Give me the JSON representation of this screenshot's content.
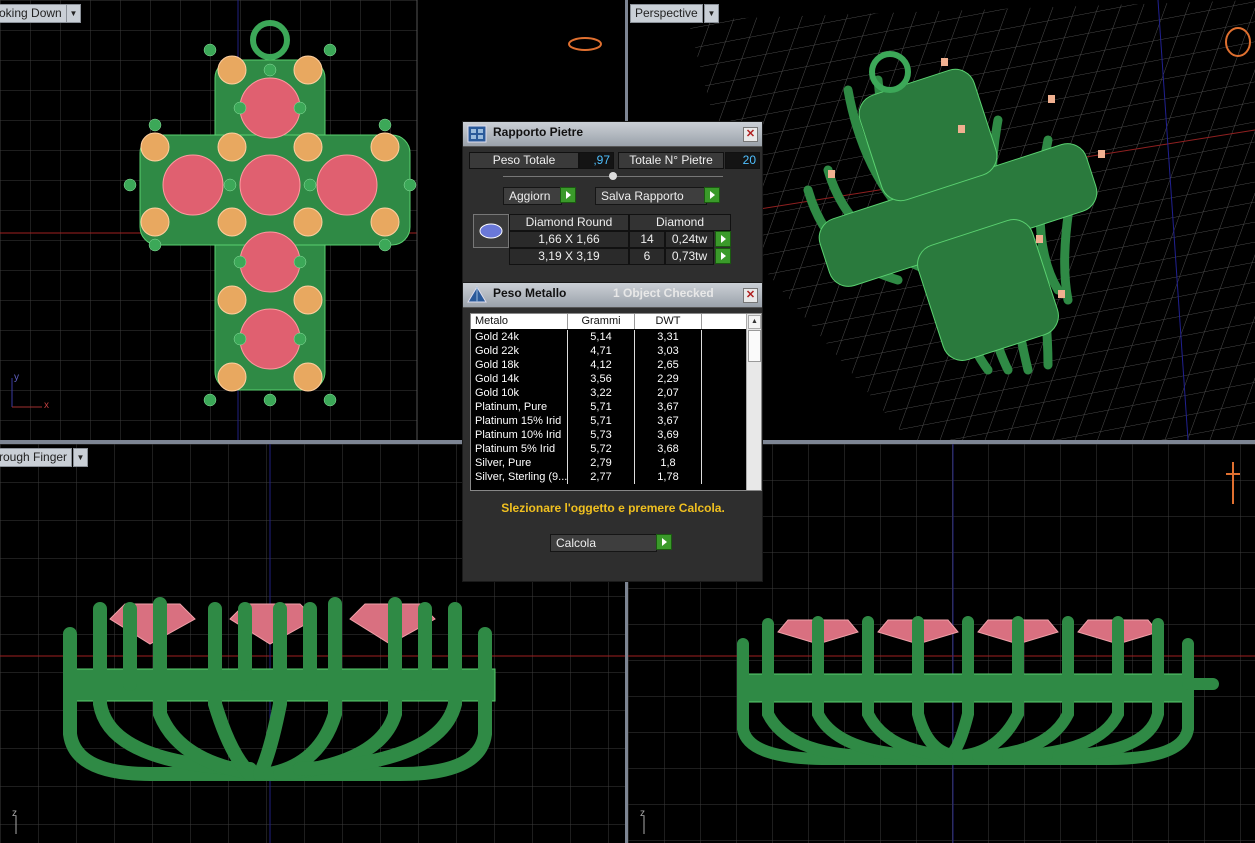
{
  "viewports": {
    "top_left": {
      "label": "oking Down"
    },
    "top_right": {
      "label": "Perspective"
    },
    "bottom_left": {
      "label": "rough Finger"
    }
  },
  "stone_report": {
    "title": "Rapporto Pietre",
    "total_weight_label": "Peso Totale",
    "total_weight_value": ",97",
    "total_stones_label": "Totale N° Pietre",
    "total_stones_value": "20",
    "update_button": "Aggiorn",
    "save_report_button": "Salva Rapporto",
    "stone_table": {
      "header_shape": "Diamond Round",
      "header_type": "Diamond",
      "rows": [
        {
          "size": "1,66 X 1,66",
          "count": "14",
          "weight": "0,24tw"
        },
        {
          "size": "3,19 X 3,19",
          "count": "6",
          "weight": "0,73tw"
        }
      ]
    }
  },
  "metal_weight": {
    "title": "Peso Metallo",
    "status": "1 Object Checked",
    "columns": [
      "Metalo",
      "Grammi",
      "DWT"
    ],
    "rows": [
      {
        "metal": "Gold 24k",
        "grams": "5,14",
        "dwt": "3,31"
      },
      {
        "metal": "Gold 22k",
        "grams": "4,71",
        "dwt": "3,03"
      },
      {
        "metal": "Gold 18k",
        "grams": "4,12",
        "dwt": "2,65"
      },
      {
        "metal": "Gold 14k",
        "grams": "3,56",
        "dwt": "2,29"
      },
      {
        "metal": "Gold 10k",
        "grams": "3,22",
        "dwt": "2,07"
      },
      {
        "metal": "Platinum, Pure",
        "grams": "5,71",
        "dwt": "3,67"
      },
      {
        "metal": "Platinum 15% Irid",
        "grams": "5,71",
        "dwt": "3,67"
      },
      {
        "metal": "Platinum 10% Irid",
        "grams": "5,73",
        "dwt": "3,69"
      },
      {
        "metal": "Platinum 5% Irid",
        "grams": "5,72",
        "dwt": "3,68"
      },
      {
        "metal": "Silver, Pure",
        "grams": "2,79",
        "dwt": "1,8"
      },
      {
        "metal": "Silver, Sterling (9...",
        "grams": "2,77",
        "dwt": "1,78"
      }
    ],
    "instruction": "Slezionare l'oggetto e premere Calcola.",
    "calc_button": "Calcola"
  },
  "axes": {
    "y": "y",
    "x": "x",
    "z": "z"
  },
  "colors": {
    "metal_green": "#2f8a45",
    "ruby": "#e06070",
    "citrine": "#e8a860",
    "grid": "#4a4a4a",
    "accent_value": "#4fc0ff",
    "instruction": "#f0c020"
  }
}
